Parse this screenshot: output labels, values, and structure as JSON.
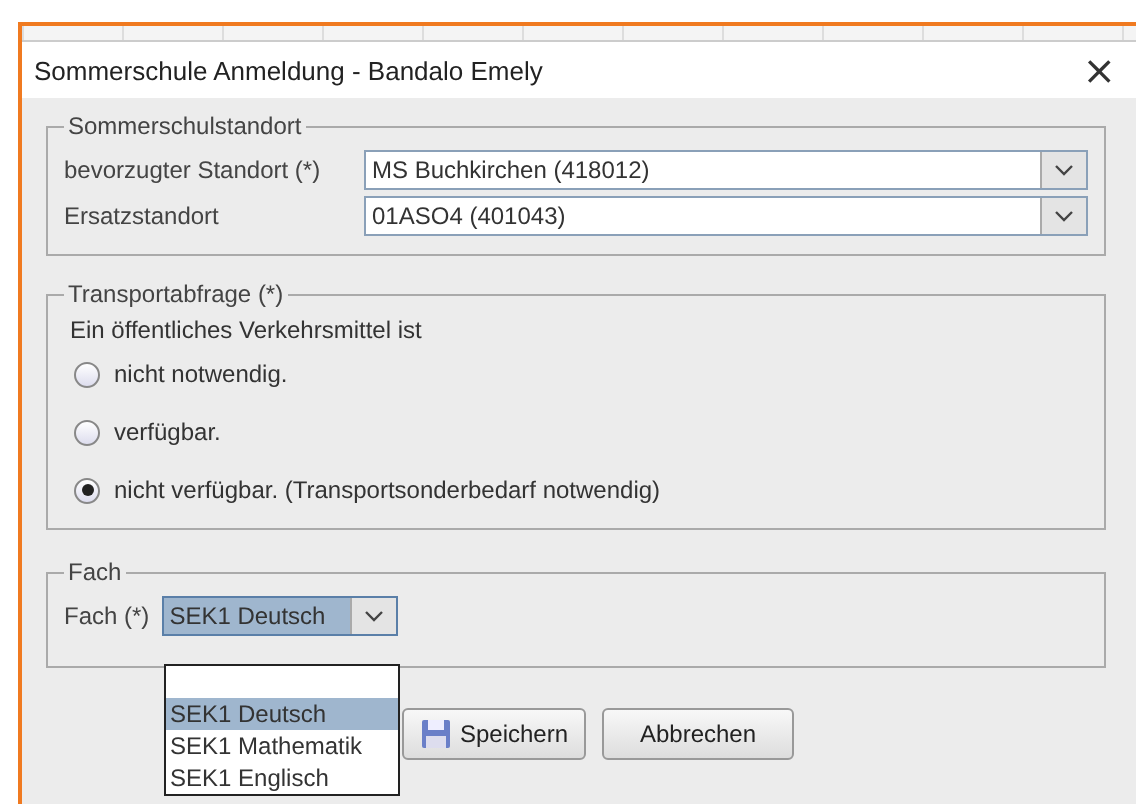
{
  "window": {
    "title": "Sommerschule Anmeldung - Bandalo Emely",
    "close": "×"
  },
  "standort": {
    "legend": "Sommerschulstandort",
    "fields": [
      {
        "label": "bevorzugter Standort (*)",
        "value": "MS Buchkirchen (418012)"
      },
      {
        "label": "Ersatzstandort",
        "value": "01ASO4 (401043)"
      }
    ]
  },
  "transport": {
    "legend": "Transportabfrage (*)",
    "intro": "Ein öffentliches Verkehrsmittel ist",
    "options": [
      {
        "label": "nicht notwendig.",
        "selected": false
      },
      {
        "label": "verfügbar.",
        "selected": false
      },
      {
        "label": "nicht verfügbar. (Transportsonderbedarf notwendig)",
        "selected": true
      }
    ]
  },
  "fach": {
    "legend": "Fach",
    "label": "Fach (*)",
    "value": "SEK1 Deutsch",
    "expanded": true,
    "options": [
      {
        "label": "SEK1 Deutsch",
        "selected": true
      },
      {
        "label": "SEK1 Mathematik",
        "selected": false
      },
      {
        "label": "SEK1 Englisch",
        "selected": false
      }
    ]
  },
  "buttons": [
    {
      "label": "Speichern",
      "kind": "save"
    },
    {
      "label": "Abbrechen",
      "kind": "plain"
    }
  ]
}
